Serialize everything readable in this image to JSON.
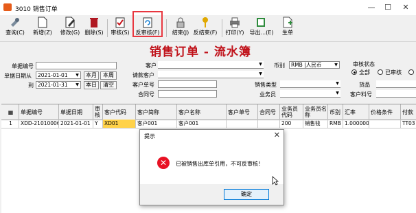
{
  "window": {
    "title": "3010 销售订单",
    "minimize": "—",
    "maximize": "☐",
    "close": "✕"
  },
  "toolbar": [
    {
      "id": "query",
      "label": "查询(C)",
      "icon": "query-icon"
    },
    {
      "id": "new",
      "label": "新增(Z)",
      "icon": "new-doc-icon"
    },
    {
      "id": "edit",
      "label": "修改(G)",
      "icon": "edit-icon"
    },
    {
      "id": "delete",
      "label": "删除(S)",
      "icon": "trash-icon"
    },
    {
      "id": "audit",
      "label": "审核(S)",
      "icon": "audit-icon"
    },
    {
      "id": "unaudit",
      "label": "反审核(F)",
      "icon": "unaudit-icon"
    },
    {
      "id": "close",
      "label": "结束(J)",
      "icon": "lock-icon"
    },
    {
      "id": "unclose",
      "label": "反结束(F)",
      "icon": "key-icon"
    },
    {
      "id": "print",
      "label": "打印(Y)",
      "icon": "printer-icon"
    },
    {
      "id": "export",
      "label": "导出...(E)",
      "icon": "export-icon"
    },
    {
      "id": "generate",
      "label": "生单",
      "icon": "generate-icon"
    }
  ],
  "page_title": "销售订单 - 流水簿",
  "filters": {
    "doc_no_label": "单据编号",
    "date_from_label": "单据日期从",
    "date_from": "2021-01-01",
    "date_to_label": "到",
    "date_to": "2021-01-31",
    "this_month": "本月",
    "this_week": "本周",
    "today": "本日",
    "clear": "清空",
    "customer_label": "客户",
    "req_customer_label": "请款客户",
    "cust_doc_label": "客户单号",
    "contract_label": "合同号",
    "currency_label": "币别",
    "currency_value": "RMB |人民币",
    "sales_type_label": "销售类型",
    "salesman_label": "业务员",
    "audit_status_label": "审核状态",
    "radio_all": "全部",
    "radio_audited": "已审核",
    "goods_label": "货品",
    "cust_item_label": "客户料号"
  },
  "table": {
    "headers": [
      "单据编号",
      "单据日期",
      "审核",
      "客户代码",
      "客户简称",
      "客户名称",
      "客户单号",
      "合同号",
      "业务员代码",
      "业务员名称",
      "币别",
      "汇率",
      "价格条件",
      "付款"
    ],
    "rows": [
      {
        "idx": "1",
        "cells": [
          "XDD-21010006",
          "2021-01-01",
          "Y",
          "XD01",
          "客户001",
          "客户001",
          "",
          "",
          "200",
          "销售钱",
          "RMB",
          "1.000000",
          "",
          "TT03"
        ]
      }
    ]
  },
  "dialog": {
    "title": "提示",
    "message": "已被销售出库单引用，不可反审核！",
    "ok": "确定",
    "close": "✕"
  },
  "colors": {
    "title_red": "#c0121a",
    "highlight_red": "#e8373f",
    "error_red": "#e81123",
    "cell_yellow": "#ffd24a"
  }
}
